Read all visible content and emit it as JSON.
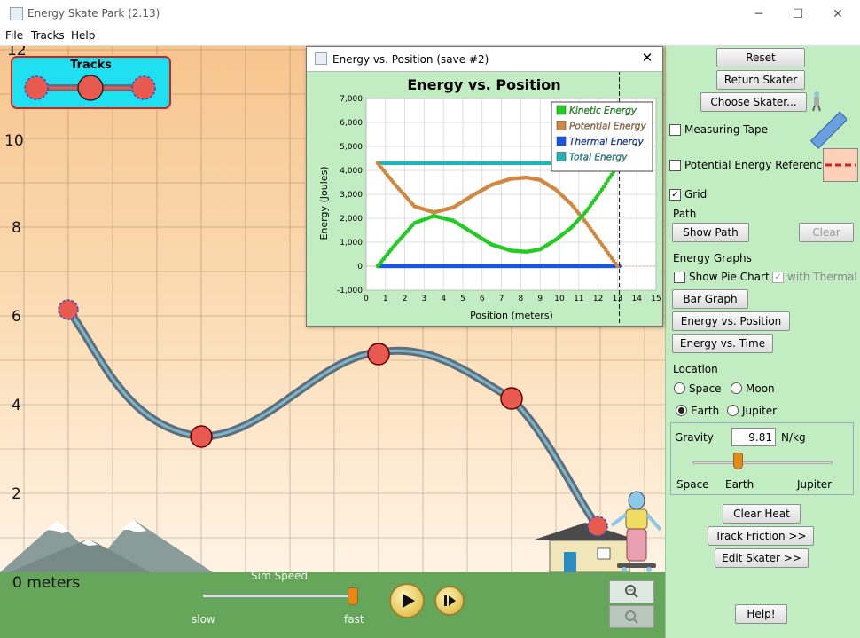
{
  "window": {
    "title": "Energy Skate Park (2.13)",
    "minimize": "─",
    "maximize": "☐",
    "close": "✕"
  },
  "menu": {
    "items": [
      "File",
      "Tracks",
      "Help"
    ]
  },
  "play": {
    "tracks_label": "Tracks",
    "y_labels": [
      "12",
      "10",
      "8",
      "6",
      "4",
      "2"
    ],
    "meters_label": "0 meters",
    "sim_speed": "Sim Speed",
    "slow": "slow",
    "fast": "fast",
    "sim_speed_value": 0.98
  },
  "graph": {
    "window_title": "Energy vs. Position (save #2)",
    "close": "✕",
    "chart_data": {
      "type": "line",
      "title": "Energy vs. Position",
      "xlabel": "Position (meters)",
      "ylabel": "Energy (Joules)",
      "xlim": [
        0,
        15
      ],
      "ylim": [
        -1000,
        7000
      ],
      "x_ticks": [
        "0",
        "1",
        "2",
        "3",
        "4",
        "5",
        "6",
        "7",
        "8",
        "9",
        "10",
        "11",
        "12",
        "13",
        "14",
        "15"
      ],
      "y_ticks": [
        "-1,000",
        "0",
        "1,000",
        "2,000",
        "3,000",
        "4,000",
        "5,000",
        "6,000",
        "7,000"
      ],
      "legend_position": "top-right",
      "grid": true,
      "cursor_x": 13.1,
      "series": [
        {
          "name": "Kinetic Energy",
          "color": "#22cc22",
          "x": [
            0.6,
            1.5,
            2.5,
            3.5,
            4.5,
            5.5,
            6.5,
            7.5,
            8.3,
            9.0,
            9.8,
            10.6,
            11.4,
            12.2,
            13.0
          ],
          "y": [
            0,
            900,
            1800,
            2100,
            1900,
            1400,
            900,
            650,
            600,
            700,
            1100,
            1600,
            2300,
            3200,
            4200
          ]
        },
        {
          "name": "Potential Energy",
          "color": "#d08840",
          "x": [
            0.6,
            1.5,
            2.5,
            3.5,
            4.5,
            5.5,
            6.5,
            7.5,
            8.3,
            9.0,
            9.8,
            10.6,
            11.4,
            12.2,
            13.0
          ],
          "y": [
            4300,
            3400,
            2500,
            2250,
            2450,
            2950,
            3400,
            3650,
            3700,
            3600,
            3200,
            2600,
            1800,
            900,
            0
          ]
        },
        {
          "name": "Thermal Energy",
          "color": "#1a56e6",
          "x": [
            0.6,
            13.1
          ],
          "y": [
            0,
            0
          ]
        },
        {
          "name": "Total Energy",
          "color": "#22b4b4",
          "x": [
            0.6,
            13.1
          ],
          "y": [
            4300,
            4300
          ]
        }
      ]
    }
  },
  "right": {
    "reset": "Reset",
    "return_skater": "Return Skater",
    "choose_skater": "Choose Skater...",
    "measuring_tape": "Measuring Tape",
    "pe_reference": "Potential Energy Reference",
    "grid": "Grid",
    "path_header": "Path",
    "show_path": "Show Path",
    "clear": "Clear",
    "energy_graphs_header": "Energy Graphs",
    "show_pie_chart": "Show Pie Chart",
    "with_thermal": "with Thermal",
    "bar_graph": "Bar Graph",
    "energy_vs_position": "Energy vs. Position",
    "energy_vs_time": "Energy vs. Time",
    "location_header": "Location",
    "space": "Space",
    "moon": "Moon",
    "earth": "Earth",
    "jupiter": "Jupiter",
    "gravity_label": "Gravity",
    "gravity_value": "9.81",
    "gravity_unit": "N/kg",
    "slider_space": "Space",
    "slider_earth": "Earth",
    "slider_jupiter": "Jupiter",
    "clear_heat": "Clear Heat",
    "track_friction": "Track Friction >>",
    "edit_skater": "Edit Skater >>",
    "help": "Help!",
    "check_mark": "✓",
    "grid_checked": true,
    "measuring_tape_checked": false,
    "pe_reference_checked": false,
    "show_pie_chart_checked": false,
    "with_thermal_checked": true
  }
}
